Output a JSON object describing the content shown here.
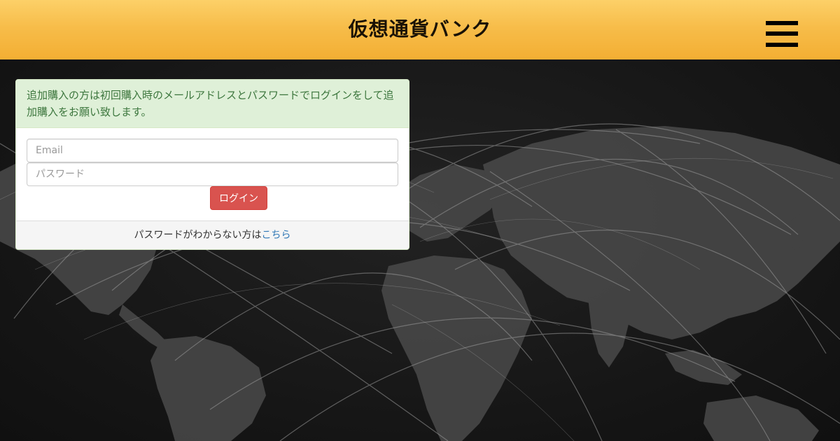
{
  "header": {
    "title": "仮想通貨バンク",
    "menu_icon": "hamburger-menu-icon"
  },
  "login": {
    "notice": "追加購入の方は初回購入時のメールアドレスとパスワードでログインをして追加購入をお願い致します。",
    "email_placeholder": "Email",
    "password_placeholder": "パスワード",
    "login_button": "ログイン",
    "forgot_text": "パスワードがわからない方は",
    "forgot_link": "こちら"
  },
  "colors": {
    "header_top": "#fcd068",
    "header_bottom": "#f3ae33",
    "notice_bg": "#dff0d8",
    "notice_text": "#3c763d",
    "button": "#d9534f",
    "link": "#337ab7",
    "background": "#151515"
  }
}
